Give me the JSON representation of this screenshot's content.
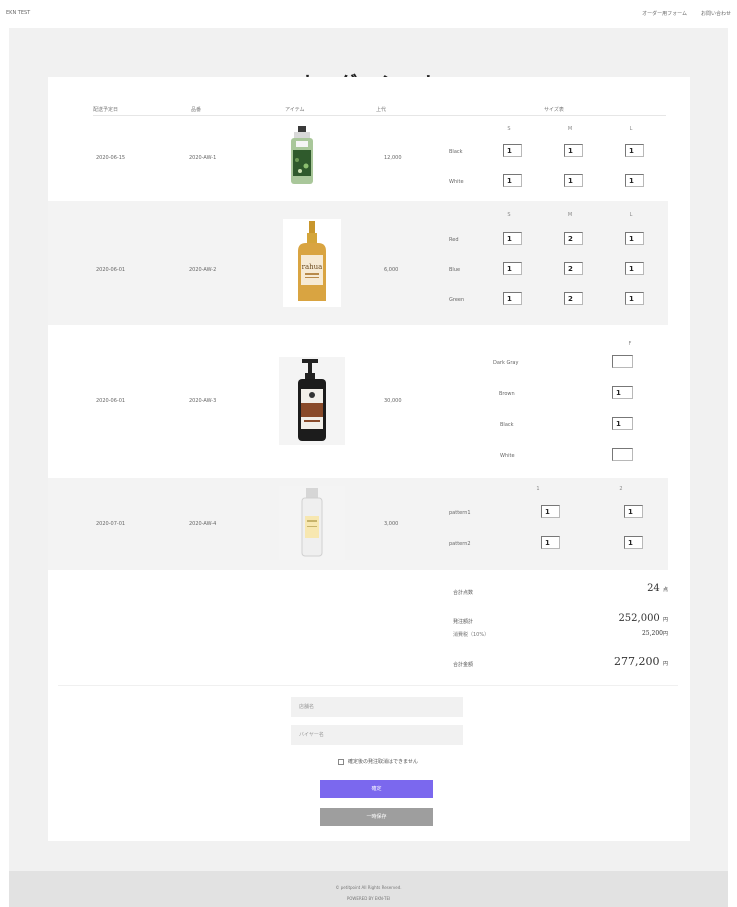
{
  "header": {
    "site_name": "EKN TEST",
    "nav": [
      "オーダー用フォーム",
      "お問い合わせ"
    ]
  },
  "page_title": "オーダーシート",
  "table": {
    "headers": [
      "配送予定日",
      "品番",
      "アイテム",
      "上代",
      "サイズ表"
    ],
    "rows": [
      {
        "date": "2020-06-15",
        "code": "2020-AW-1",
        "price": "12,000",
        "sizes": [
          "S",
          "M",
          "L"
        ],
        "colors": [
          {
            "name": "Black",
            "qty": [
              "1",
              "1",
              "1"
            ]
          },
          {
            "name": "White",
            "qty": [
              "1",
              "1",
              "1"
            ]
          }
        ]
      },
      {
        "date": "2020-06-01",
        "code": "2020-AW-2",
        "price": "6,000",
        "sizes": [
          "S",
          "M",
          "L"
        ],
        "colors": [
          {
            "name": "Red",
            "qty": [
              "1",
              "2",
              "1"
            ]
          },
          {
            "name": "Blue",
            "qty": [
              "1",
              "2",
              "1"
            ]
          },
          {
            "name": "Green",
            "qty": [
              "1",
              "2",
              "1"
            ]
          }
        ]
      },
      {
        "date": "2020-06-01",
        "code": "2020-AW-3",
        "price": "30,000",
        "sizes": [
          "F"
        ],
        "colors": [
          {
            "name": "Dark Gray",
            "qty": [
              ""
            ]
          },
          {
            "name": "Brown",
            "qty": [
              "1"
            ]
          },
          {
            "name": "Black",
            "qty": [
              "1"
            ]
          },
          {
            "name": "White",
            "qty": [
              ""
            ]
          }
        ]
      },
      {
        "date": "2020-07-01",
        "code": "2020-AW-4",
        "price": "3,000",
        "sizes": [
          "1",
          "2"
        ],
        "colors": [
          {
            "name": "pattern1",
            "qty": [
              "1",
              "1"
            ]
          },
          {
            "name": "pattern2",
            "qty": [
              "1",
              "1"
            ]
          }
        ]
      }
    ]
  },
  "summary": {
    "total_qty_label": "合計点数",
    "total_qty": "24",
    "total_qty_unit": "点",
    "subtotal_label": "発注額計",
    "subtotal": "252,000",
    "yen": "円",
    "tax_label": "消費税（10%）",
    "tax": "25,200",
    "total_label": "合計金額",
    "total": "277,200"
  },
  "form": {
    "store_placeholder": "店舗名",
    "buyer_placeholder": "バイヤー名",
    "notice": "確定後の発注取消はできません",
    "confirm_label": "確定",
    "draft_label": "一時保存"
  },
  "footer": {
    "copyright": "© petitpoint All Rights Reserved.",
    "powered": "POWERED BY EKN-TEI"
  },
  "colors": {
    "confirm": "#7b68ee",
    "draft": "#9e9e9e",
    "card_bg": "#f1f1f1"
  }
}
